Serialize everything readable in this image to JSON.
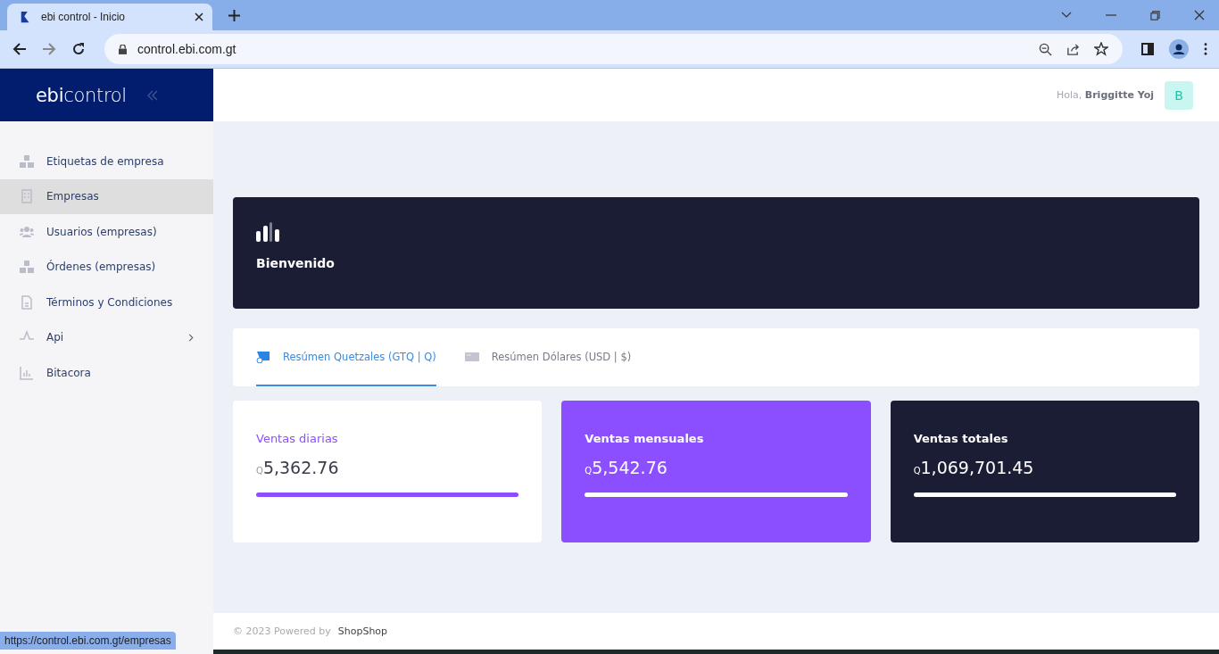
{
  "browser": {
    "tab_title": "ebi control - Inicio",
    "url": "control.ebi.com.gt",
    "status_url": "https://control.ebi.com.gt/empresas"
  },
  "logo": "**ebi**control",
  "header": {
    "greeting": "Hola,",
    "user": "Briggitte Yoj",
    "avatar": "B"
  },
  "sidebar": {
    "items": [
      {
        "label": "Etiquetas de empresa",
        "selected": false,
        "submenu": false
      },
      {
        "label": "Empresas",
        "selected": true,
        "submenu": false
      },
      {
        "label": "Usuarios (empresas)",
        "selected": false,
        "submenu": false
      },
      {
        "label": "Órdenes (empresas)",
        "selected": false,
        "submenu": false
      },
      {
        "label": "Términos y Condiciones",
        "selected": false,
        "submenu": false
      },
      {
        "label": "Api",
        "selected": false,
        "submenu": true
      },
      {
        "label": "Bitacora",
        "selected": false,
        "submenu": false
      }
    ]
  },
  "banner": {
    "title": "Bienvenido"
  },
  "tabs": [
    {
      "label": "Resúmen Quetzales (GTQ | Q)",
      "selected": true
    },
    {
      "label": "Resúmen Dólares (USD | $)",
      "selected": false
    }
  ],
  "stats": [
    {
      "kind": "light",
      "title": "Ventas diarias",
      "currency": "Q",
      "amount": "5,362.76"
    },
    {
      "kind": "purple",
      "title": "Ventas mensuales",
      "currency": "Q",
      "amount": "5,542.76"
    },
    {
      "kind": "dark",
      "title": "Ventas totales",
      "currency": "Q",
      "amount": "1,069,701.45"
    }
  ],
  "footer": {
    "text": "© 2023 Powered by",
    "brand": "ShopShop"
  }
}
